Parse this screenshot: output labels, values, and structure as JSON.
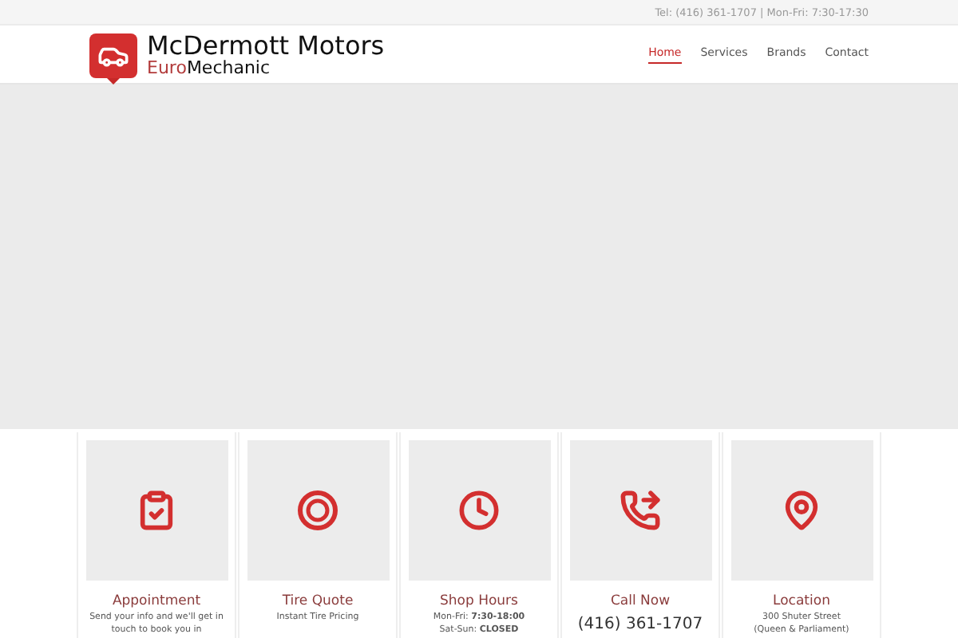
{
  "top_bar": {
    "contact": "Tel: (416) 361-1707 | Mon-Fri: 7:30-17:30"
  },
  "header": {
    "brand": {
      "name": "McDermott Motors",
      "tagline_accent": "Euro",
      "tagline_rest": "Mechanic"
    },
    "nav": [
      {
        "label": "Home",
        "selected": true
      },
      {
        "label": "Services",
        "selected": false
      },
      {
        "label": "Brands",
        "selected": false
      },
      {
        "label": "Contact",
        "selected": false
      }
    ]
  },
  "cards": [
    {
      "kind": "appointment",
      "title": "Appointment",
      "lines": [
        "Send your info and we'll get in",
        "touch to book you in"
      ]
    },
    {
      "kind": "tire",
      "title": "Tire Quote",
      "lines": [
        "Instant Tire Pricing"
      ]
    },
    {
      "kind": "hours",
      "title": "Shop Hours",
      "lines": [
        "Mon-Fri: **7:30-18:00**",
        "Sat-Sun: **CLOSED**"
      ]
    },
    {
      "kind": "phone",
      "title": "Call Now",
      "phone": "(416) 361-1707"
    },
    {
      "kind": "location",
      "title": "Location",
      "lines": [
        "300 Shuter Street",
        "(Queen & Parliament)"
      ]
    }
  ]
}
